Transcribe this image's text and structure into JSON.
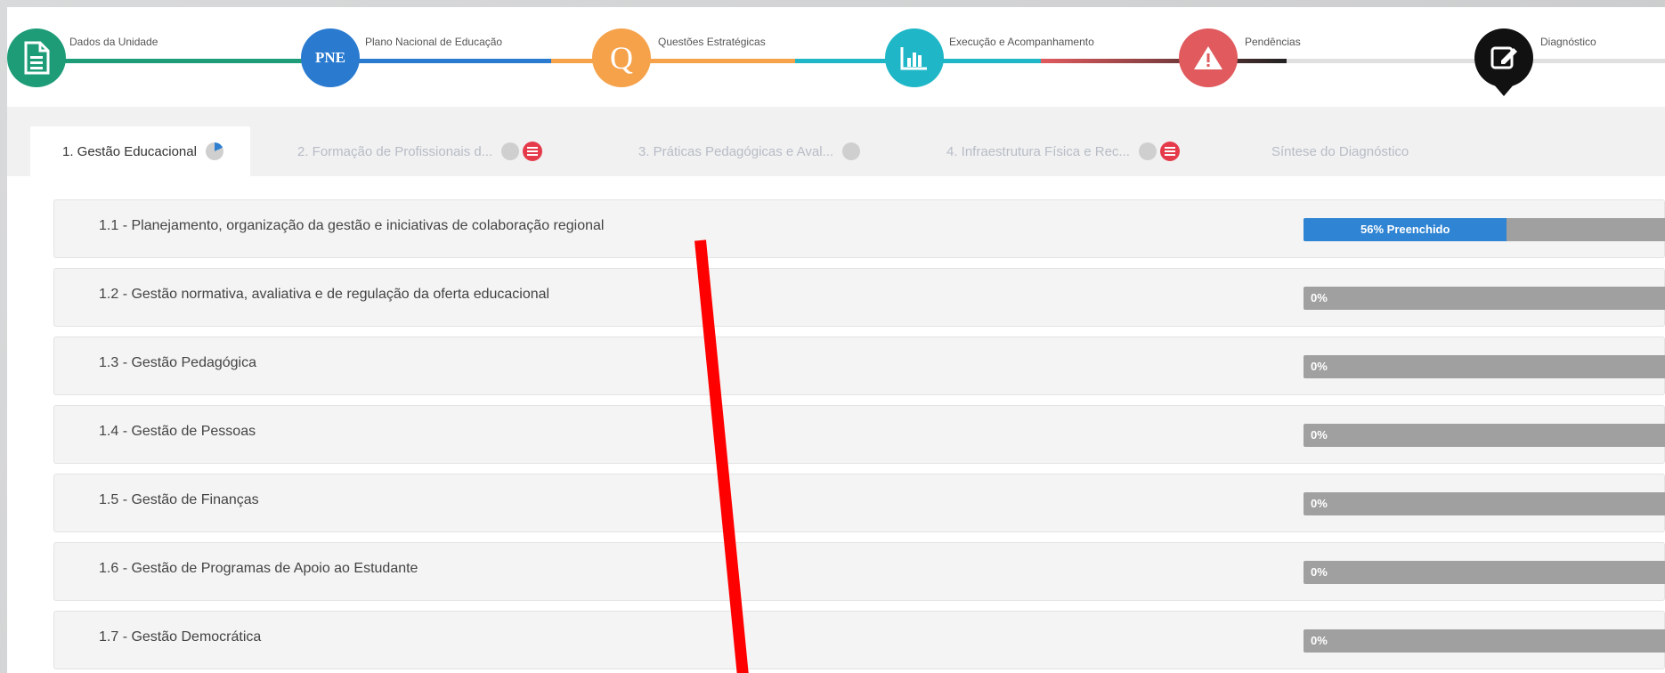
{
  "wizard": {
    "steps": [
      {
        "label": "Dados da Unidade",
        "icon": "document-icon",
        "color": "#1e9c78"
      },
      {
        "label": "Plano Nacional de Educação",
        "icon": "pne-badge",
        "badge": "PNE",
        "color": "#2a7bd0"
      },
      {
        "label": "Questões Estratégicas",
        "icon": "q-icon",
        "badge": "Q",
        "color": "#f5a24b"
      },
      {
        "label": "Execução e Acompanhamento",
        "icon": "bar-chart-icon",
        "color": "#1fb7c7"
      },
      {
        "label": "Pendências",
        "icon": "warning-icon",
        "color": "#e05a5e"
      },
      {
        "label": "Diagnóstico",
        "icon": "edit-icon",
        "color": "#111111"
      }
    ]
  },
  "tabs": [
    {
      "label": "1. Gestão Educacional",
      "active": true
    },
    {
      "label": "2. Formação de Profissionais d..."
    },
    {
      "label": "3. Práticas Pedagógicas e Aval..."
    },
    {
      "label": "4. Infraestrutura Física e Rec..."
    },
    {
      "label": "Síntese do Diagnóstico"
    }
  ],
  "sections": [
    {
      "title": "1.1 - Planejamento, organização da gestão e iniciativas de colaboração regional",
      "progress": 0.56,
      "progress_label": "56% Preenchido"
    },
    {
      "title": "1.2 - Gestão normativa, avaliativa e de regulação da oferta educacional",
      "progress": 0,
      "progress_label": "0%"
    },
    {
      "title": "1.3 - Gestão Pedagógica",
      "progress": 0,
      "progress_label": "0%"
    },
    {
      "title": "1.4 - Gestão de Pessoas",
      "progress": 0,
      "progress_label": "0%"
    },
    {
      "title": "1.5 - Gestão de Finanças",
      "progress": 0,
      "progress_label": "0%"
    },
    {
      "title": "1.6 - Gestão de Programas de Apoio ao Estudante",
      "progress": 0,
      "progress_label": "0%"
    },
    {
      "title": "1.7 - Gestão Democrática",
      "progress": 0,
      "progress_label": "0%"
    }
  ],
  "colors": {
    "progress_fill": "#2f84d3",
    "progress_track": "#a0a0a0",
    "annotation": "#ff0000"
  }
}
